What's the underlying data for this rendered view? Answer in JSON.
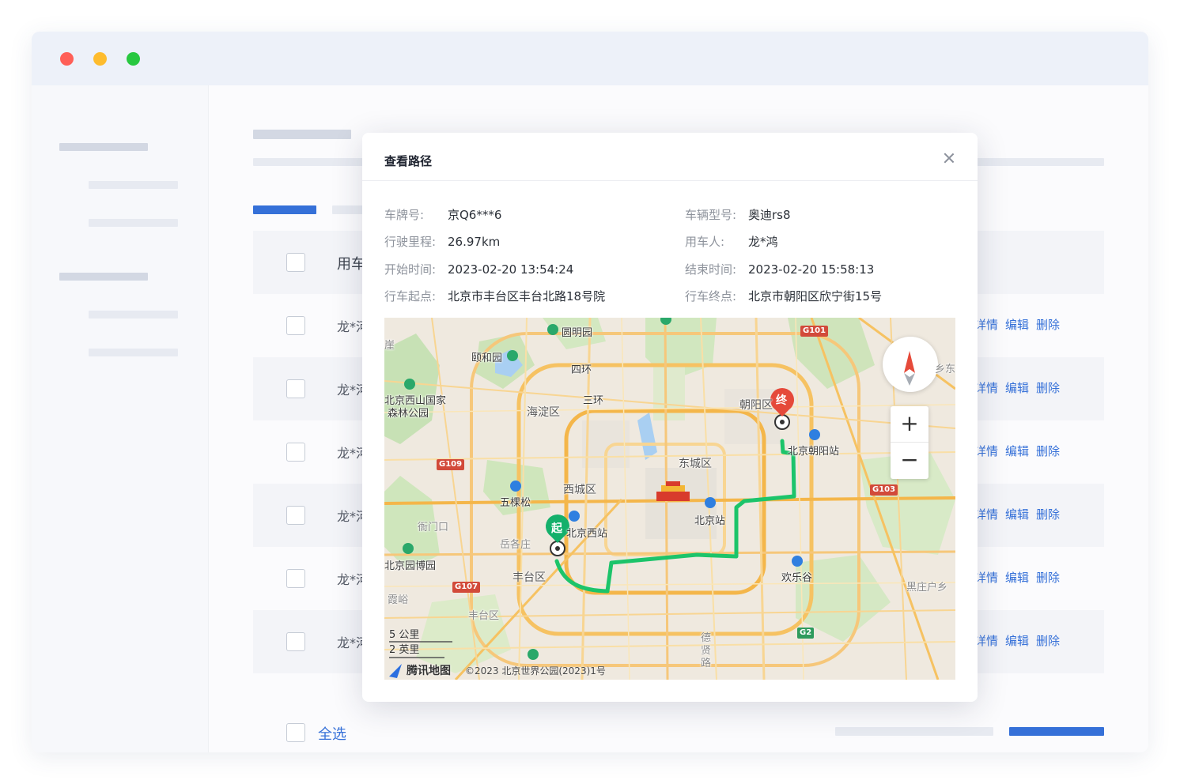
{
  "window": {
    "controls": [
      "close",
      "minimize",
      "maximize"
    ]
  },
  "table": {
    "header_name": "用车",
    "rows": [
      {
        "name": "龙*河",
        "ops": [
          "详情",
          "编辑",
          "删除"
        ]
      },
      {
        "name": "龙*河",
        "ops": [
          "详情",
          "编辑",
          "删除"
        ]
      },
      {
        "name": "龙*河",
        "ops": [
          "详情",
          "编辑",
          "删除"
        ]
      },
      {
        "name": "龙*河",
        "ops": [
          "详情",
          "编辑",
          "删除"
        ]
      },
      {
        "name": "龙*河",
        "ops": [
          "详情",
          "编辑",
          "删除"
        ]
      },
      {
        "name": "龙*河",
        "ops": [
          "详情",
          "编辑",
          "删除"
        ]
      }
    ],
    "select_all": "全选"
  },
  "modal": {
    "title": "查看路径",
    "fields": {
      "plate": {
        "label": "车牌号:",
        "value": "京Q6***6"
      },
      "model": {
        "label": "车辆型号:",
        "value": "奥迪rs8"
      },
      "mileage": {
        "label": "行驶里程:",
        "value": "26.97km"
      },
      "user": {
        "label": "用车人:",
        "value": "龙*鸿"
      },
      "start_time": {
        "label": "开始时间:",
        "value": "2023-02-20 13:54:24"
      },
      "end_time": {
        "label": "结束时间:",
        "value": "2023-02-20 15:58:13"
      },
      "start_point": {
        "label": "行车起点:",
        "value": "北京市丰台区丰台北路18号院"
      },
      "end_point": {
        "label": "行车终点:",
        "value": "北京市朝阳区欣宁街15号"
      }
    }
  },
  "map": {
    "start_marker": "起",
    "end_marker": "终",
    "route_color": "#1cc46a",
    "labels": {
      "yuanmingyuan": "圆明园",
      "yiheyuan": "颐和园",
      "sihuan": "四环",
      "sanhuan": "三环",
      "xishan": "北京西山国家",
      "xishan2": "森林公园",
      "haidian": "海淀区",
      "chaoyang": "朝阳区",
      "chaoyang_station": "北京朝阳站",
      "dongcheng": "东城区",
      "xicheng": "西城区",
      "wukesong": "五棵松",
      "beijing_station": "北京站",
      "west_station": "北京西站",
      "jiekou": "衙门口",
      "yuegezhuang": "岳各庄",
      "fengtai": "丰台区",
      "fengtai2": "丰台区",
      "garden_expo": "北京园博园",
      "huanlegu": "欢乐谷",
      "heizhuanghu": "黑庄户乡",
      "deshen_road": "德贤路",
      "feng": "霞峪",
      "xiangdong": "乡东",
      "ya": "崖"
    },
    "highways": [
      "G101",
      "G109",
      "G103",
      "G107",
      "G2"
    ],
    "scale": [
      "5 公里",
      "2 英里"
    ],
    "brand": "腾讯地图",
    "copyright": "©2023 北京世界公园(2023)1号",
    "zoom_in": "+",
    "zoom_out": "−"
  }
}
